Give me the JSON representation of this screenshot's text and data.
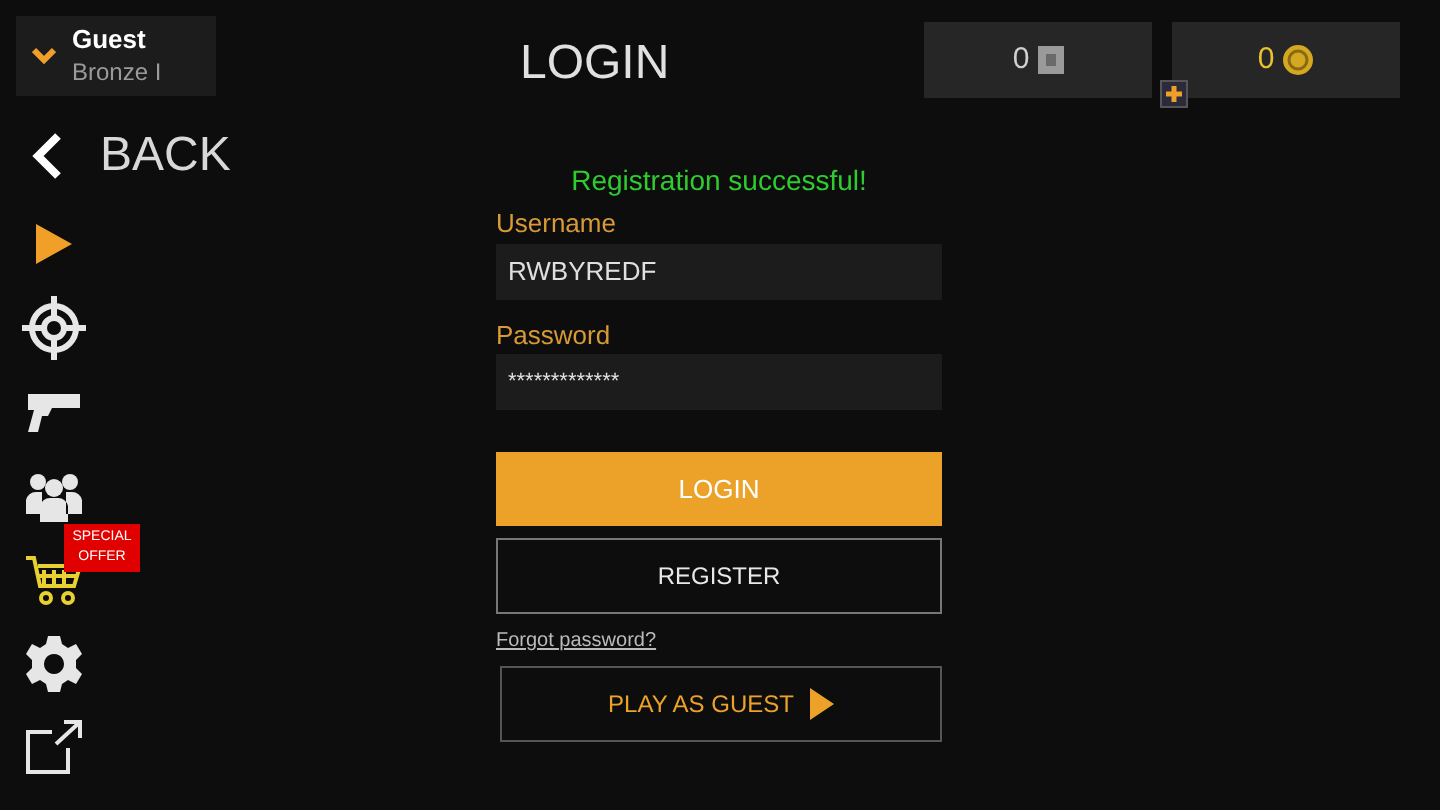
{
  "profile": {
    "name": "Guest",
    "rank": "Bronze I"
  },
  "title": "LOGIN",
  "currencies": [
    {
      "kind": "cash",
      "amount": "0"
    },
    {
      "kind": "gold",
      "amount": "0"
    }
  ],
  "back": "BACK",
  "nav": [
    {
      "kind": "play",
      "selected": true
    },
    {
      "kind": "target",
      "selected": false
    },
    {
      "kind": "pistol",
      "selected": false
    },
    {
      "kind": "people",
      "selected": false
    },
    {
      "kind": "cart",
      "selected": false,
      "badge": "SPECIAL OFFER"
    },
    {
      "kind": "gear",
      "selected": false
    },
    {
      "kind": "external",
      "selected": false
    }
  ],
  "form": {
    "message": "Registration successful!",
    "username": {
      "label": "Username",
      "value": "RWBYREDF"
    },
    "password": {
      "label": "Password",
      "value": "*************"
    },
    "login": "LOGIN",
    "register": "REGISTER",
    "forgot": "Forgot password?",
    "guest": "PLAY AS GUEST"
  }
}
